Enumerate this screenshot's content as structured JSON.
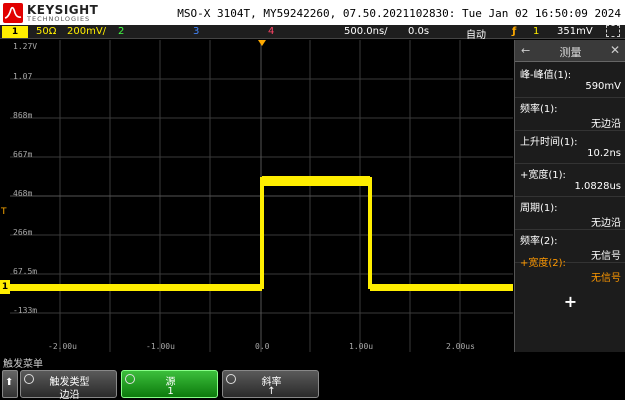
{
  "header": {
    "brand": "KEYSIGHT",
    "brand_sub": "TECHNOLOGIES",
    "model_line": "MSO-X 3104T, MY59242260, 07.50.2021102830: Tue Jan 02 16:50:09 2024"
  },
  "statusbar": {
    "ch1_box": "1",
    "ch1_impedance": "50Ω",
    "ch1_scale": "200mV/",
    "ch2": "2",
    "ch3": "3",
    "ch4": "4",
    "timebase": "500.0ns/",
    "delay": "0.0s",
    "acq_mode": "自动",
    "trigger_source": "1",
    "trigger_level": "351mV",
    "colors": {
      "ch1": "#ffee00",
      "ch2": "#44ff44",
      "ch3": "#4488ff",
      "ch4": "#ff4466",
      "trigger": "#ffaa00"
    }
  },
  "grid": {
    "y_labels": [
      "1.27V",
      "1.07",
      "868m",
      "667m",
      "468m",
      "266m",
      "67.5m",
      "-133m"
    ],
    "x_labels": [
      "-2.00u",
      "-1.00u",
      "0.0",
      "1.00u",
      "2.00us"
    ],
    "ground_marker": "1"
  },
  "panel": {
    "title": "测量",
    "measurements": [
      {
        "name": "峰-峰值(1):",
        "value": "590mV",
        "color": "#ffffff"
      },
      {
        "name": "频率(1):",
        "value": "无边沿",
        "color": "#ffffff"
      },
      {
        "name": "上升时间(1):",
        "value": "10.2ns",
        "color": "#ffffff"
      },
      {
        "name": "+宽度(1):",
        "value": "1.0828us",
        "color": "#ffffff"
      },
      {
        "name": "周期(1):",
        "value": "无边沿",
        "color": "#ffffff"
      },
      {
        "name": "频率(2):",
        "value": "无信号",
        "color": "#ffffff"
      },
      {
        "name": "+宽度(2):",
        "value": "无信号",
        "color": "#ff9900"
      }
    ],
    "add_label": "+"
  },
  "softkeys": {
    "menu_title": "触发菜单",
    "keys": [
      {
        "label": "触发类型",
        "value": "边沿",
        "active": false
      },
      {
        "label": "源",
        "value": "1",
        "active": true
      },
      {
        "label": "斜率",
        "value": "↑",
        "active": false
      }
    ]
  }
}
